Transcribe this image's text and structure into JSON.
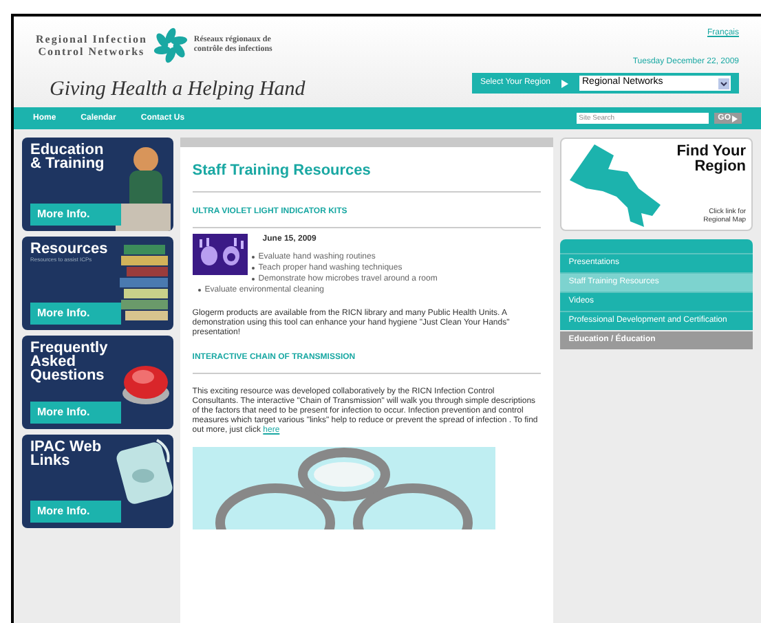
{
  "header": {
    "logo_en": [
      "Regional Infection",
      "Control Networks"
    ],
    "logo_fr": [
      "Réseaux régionaux de",
      "contrôle des infections"
    ],
    "tagline": "Giving Health a Helping Hand",
    "language_link": "Français",
    "date": "Tuesday December 22, 2009",
    "region_select": {
      "label": "Select Your Region",
      "value": "Regional Networks"
    }
  },
  "nav": {
    "items": [
      "Home",
      "Calendar",
      "Contact Us"
    ],
    "search": {
      "placeholder": "Site Search"
    },
    "go_button": "GO"
  },
  "promos": [
    {
      "title": "Education & Training",
      "button": "More Info."
    },
    {
      "title": "Resources",
      "subtitle": "Resources to assist ICPs",
      "button": "More Info."
    },
    {
      "title": "Frequently Asked Questions",
      "button": "More Info."
    },
    {
      "title": "IPAC Web Links",
      "button": "More Info."
    }
  ],
  "content": {
    "title": "Staff Training Resources",
    "sections": [
      {
        "heading": "ULTRA VIOLET LIGHT INDICATOR KITS",
        "date": "June 15, 2009",
        "bullets": [
          "Evaluate hand washing routines",
          "Teach proper hand washing techniques",
          "Demonstrate how microbes travel around a room"
        ],
        "more_bullets": [
          "Evaluate environmental cleaning"
        ],
        "text": "Glogerm products are available from the RICN library and many Public Health Units. A demonstration using this tool can enhance your hand hygiene \"Just Clean Your Hands\" presentation!"
      },
      {
        "heading": "INTERACTIVE CHAIN OF TRANSMISSION",
        "text": "This exciting resource was developed collaboratively by the RICN Infection Control Consultants. The interactive \"Chain of Transmission\" will walk you through simple descriptions of the factors that need to be present for infection to occur. Infection prevention and control measures which target various \"links\" help to reduce or prevent the spread of infection . To find out more, just click",
        "link": "here"
      }
    ]
  },
  "region_box": {
    "title": [
      "Find Your",
      "Region"
    ],
    "caption": [
      "Click link for",
      "Regional Map"
    ]
  },
  "side_menu": [
    {
      "label": "Presentations",
      "selected": false
    },
    {
      "label": "Staff Training Resources",
      "selected": true
    },
    {
      "label": "Videos",
      "selected": false
    },
    {
      "label": "Professional Development and Certification",
      "selected": false
    }
  ],
  "side_footer": "Education / Éducation"
}
